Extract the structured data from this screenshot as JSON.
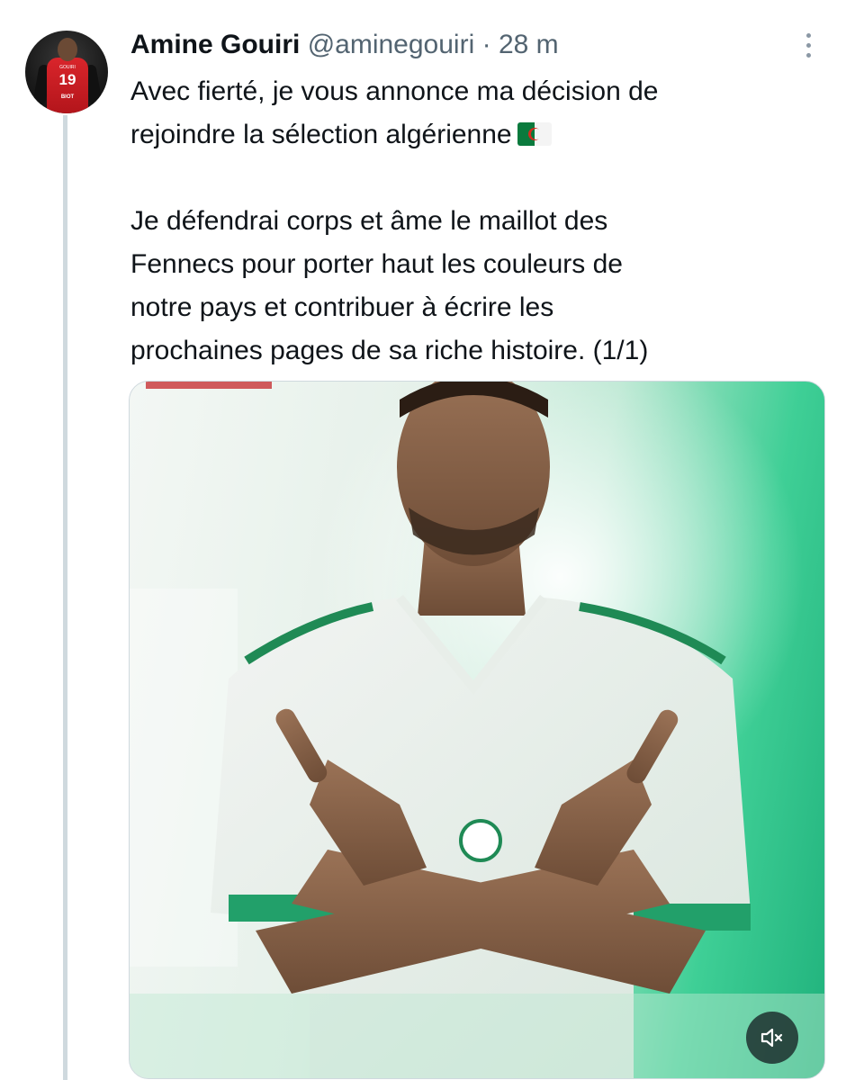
{
  "tweet": {
    "author": {
      "display_name": "Amine Gouiri",
      "handle": "@aminegouiri",
      "avatar": {
        "jersey_name": "GOUIRI",
        "jersey_number": "19",
        "jersey_sponsor": "BIOT"
      }
    },
    "separator": "·",
    "timestamp": "28 m",
    "text": {
      "line_1": "Avec fierté, je vous annonce ma décision de",
      "line_2": "rejoindre la sélection algérienne",
      "line_3": "Je défendrai corps et âme le maillot des",
      "line_4": "Fennecs pour porter haut les couleurs de",
      "line_5": "notre pays et contribuer à écrire les",
      "line_6": "prochaines pages de sa riche histoire. (1/1)"
    },
    "emoji": "algeria-flag-icon",
    "icons": {
      "more": "more-options-icon",
      "mute": "volume-muted-icon"
    },
    "colors": {
      "text_primary": "#0f1419",
      "text_secondary": "#536471",
      "thread_line": "#cfd9de",
      "media_accent": "#20b27c"
    }
  }
}
